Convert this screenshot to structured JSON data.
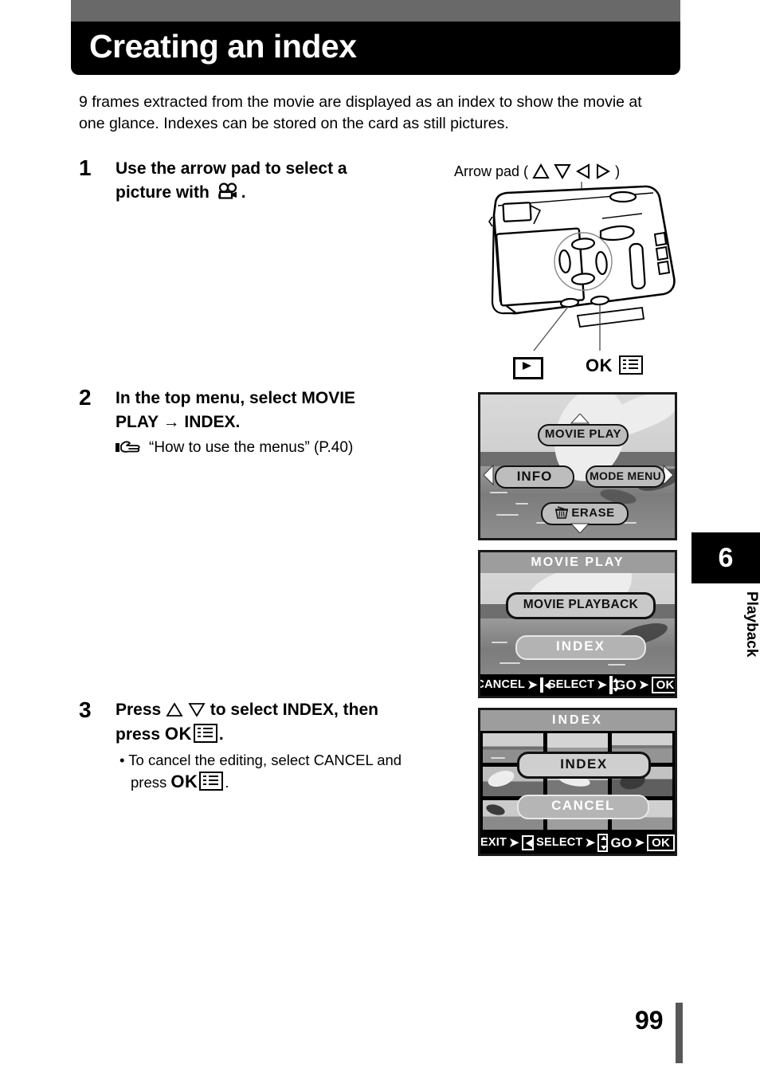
{
  "header": {
    "title": "Creating an index",
    "bar_color": "#000000",
    "accent_color": "#696969"
  },
  "intro": "9 frames extracted from the movie are displayed as an index to show the movie at one glance. Indexes can be stored on the card as still pictures.",
  "steps": [
    {
      "number": "1",
      "heading_line1": "Use the arrow pad to select a",
      "heading_line2": "picture with",
      "heading_icon": "movie-camera-icon",
      "heading_tail": "."
    },
    {
      "number": "2",
      "heading_line1": "In the top menu, select MOVIE",
      "heading_line2": "PLAY → INDEX.",
      "reference_icon": "pointing-hand-icon",
      "reference": "“How to use the menus” (P.40)"
    },
    {
      "number": "3",
      "heading_pre": "Press",
      "heading_keys": "up-down-arrow-icons",
      "heading_mid": "to select INDEX, then",
      "heading_line2_pre": "press",
      "heading_ok": "OK",
      "heading_menu_icon": "menu-list-icon",
      "heading_line2_tail": ".",
      "bullet_line1": "• To cancel the editing, select CANCEL and",
      "bullet_line2_pre": "press",
      "bullet_ok": "OK",
      "bullet_menu_icon": "menu-list-icon",
      "bullet_tail": "."
    }
  ],
  "camera_figure": {
    "arrow_pad_label_pre": "Arrow pad (",
    "arrow_pad_label_post": ")",
    "arrow_glyphs": [
      "triangle-up-icon",
      "triangle-down-icon",
      "triangle-left-icon",
      "triangle-right-icon"
    ],
    "play_button_label": "play-button-icon",
    "ok_button_label": "OK",
    "ok_menu_icon": "menu-list-icon"
  },
  "lcd_panels": [
    {
      "name": "top-menu",
      "top_item": "MOVIE  PLAY",
      "left_item": "INFO",
      "right_item": "MODE  MENU",
      "bottom_item": "ERASE",
      "bottom_item_icon": "trash-icon"
    },
    {
      "name": "movie-play-menu",
      "title": "MOVIE PLAY",
      "items": [
        {
          "label": "MOVIE  PLAYBACK",
          "selected": true
        },
        {
          "label": "INDEX",
          "selected": false
        }
      ],
      "footer": {
        "cancel_label": "CANCEL",
        "select_label": "SELECT",
        "go_label": "GO",
        "ok_label": "OK",
        "left_key_icon": "left-key-icon",
        "updown_key_icon": "up-down-key-icon"
      }
    },
    {
      "name": "index-menu",
      "title": "INDEX",
      "items": [
        {
          "label": "INDEX",
          "selected": true
        },
        {
          "label": "CANCEL",
          "selected": false
        }
      ],
      "footer": {
        "exit_label": "EXIT",
        "select_label": "SELECT",
        "go_label": "GO",
        "ok_label": "OK",
        "left_key_icon": "left-key-icon",
        "updown_key_icon": "up-down-key-icon"
      }
    }
  ],
  "chapter_tab": {
    "number": "6",
    "name": "Playback"
  },
  "page_number": "99"
}
